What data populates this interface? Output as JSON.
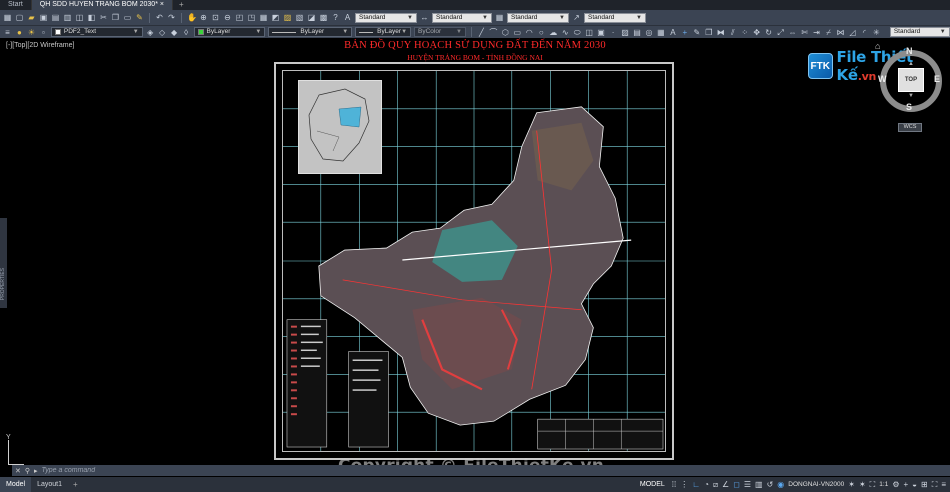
{
  "tabs": {
    "start": "Start",
    "active": "QH SDD HUYEN TRANG BOM 2030*",
    "close": "×",
    "add": "+"
  },
  "toolbar": {
    "text_style": "Standard",
    "dim_style": "Standard",
    "table_style": "Standard",
    "mleader_style": "Standard",
    "layer": "PDF2_Text",
    "color": "ByLayer",
    "linetype": "ByLayer",
    "lineweight": "ByLayer",
    "plot_style": "ByColor",
    "plot_standard": "Standard"
  },
  "viewport": {
    "label": "[-][Top][2D Wireframe]",
    "props_label": "PROPERTIES",
    "map_title": "BẢN ĐỒ QUY HOẠCH SỬ DỤNG ĐẤT ĐẾN NĂM 2030",
    "map_subtitle": "HUYỆN TRẢNG BOM - TỈNH ĐỒNG NAI",
    "watermark": "Copyright © FileThietKe.vn",
    "axis_y": "Y"
  },
  "logo": {
    "mark": "FTK",
    "name": "File Thiết Kế",
    "tld": ".vn"
  },
  "viewcube": {
    "north": "N",
    "south": "S",
    "east": "E",
    "west": "W",
    "face": "TOP",
    "wcs": "WCS"
  },
  "command": {
    "placeholder": "Type a command"
  },
  "status": {
    "model_tab": "Model",
    "layout_tab": "Layout1",
    "add": "+",
    "model_btn": "MODEL",
    "coord_system": "DONGNAI-VN2000",
    "scale": "1:1"
  },
  "colors": {
    "map_title": "#ff2a2a",
    "ribbon": "#3b4453",
    "grid": "#7ed6e0"
  }
}
